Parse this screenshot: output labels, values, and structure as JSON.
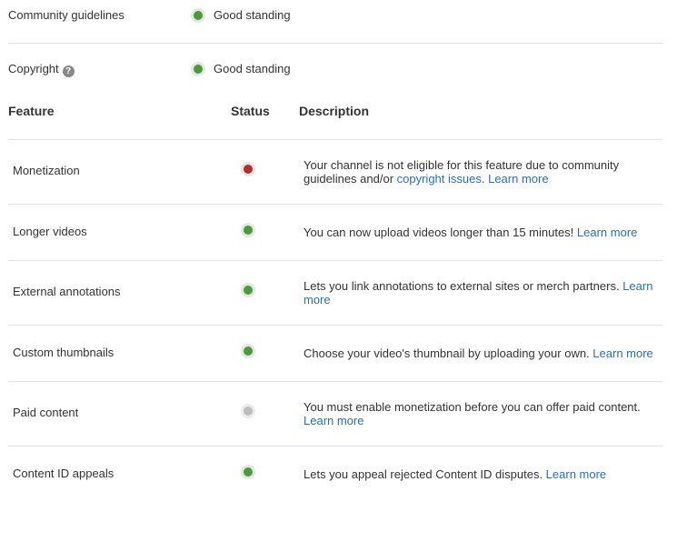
{
  "standing": [
    {
      "label": "Community guidelines",
      "status": "green",
      "value": "Good standing",
      "help": false
    },
    {
      "label": "Copyright",
      "status": "green",
      "value": "Good standing",
      "help": true
    }
  ],
  "help_glyph": "?",
  "header": {
    "feature": "Feature",
    "status": "Status",
    "description": "Description"
  },
  "features": [
    {
      "name": "Monetization",
      "status": "red",
      "desc_text": "Your channel is not eligible for this feature due to community guidelines and/or ",
      "desc_link1": "copyright issues",
      "desc_mid": ". ",
      "learn_more": "Learn more"
    },
    {
      "name": "Longer videos",
      "status": "green",
      "desc_text": "You can now upload videos longer than 15 minutes! ",
      "learn_more": "Learn more"
    },
    {
      "name": "External annotations",
      "status": "green",
      "desc_text": "Lets you link annotations to external sites or merch partners. ",
      "learn_more": "Learn more"
    },
    {
      "name": "Custom thumbnails",
      "status": "green",
      "desc_text": "Choose your video's thumbnail by uploading your own. ",
      "learn_more": "Learn more"
    },
    {
      "name": "Paid content",
      "status": "gray",
      "desc_text": "You must enable monetization before you can offer paid content. ",
      "learn_more": "Learn more"
    },
    {
      "name": "Content ID appeals",
      "status": "green",
      "desc_text": "Lets you appeal rejected Content ID disputes. ",
      "learn_more": "Learn more"
    }
  ],
  "colors": {
    "green": "#4b9b38",
    "red": "#b22f30",
    "gray": "#bdbdbd",
    "link": "#2a6ebb"
  }
}
